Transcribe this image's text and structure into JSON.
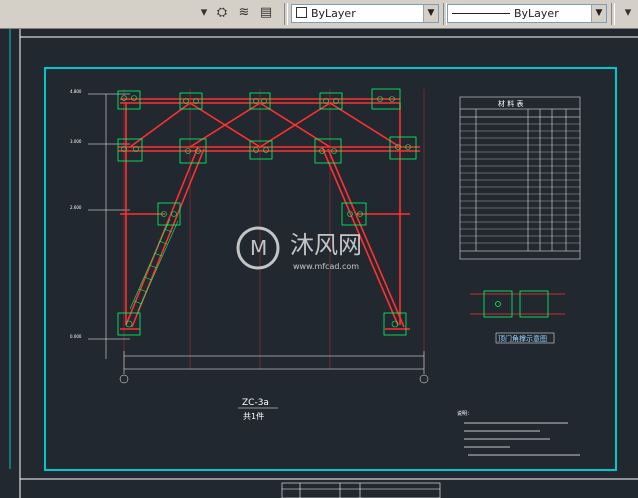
{
  "toolbar": {
    "icons": [
      "layer-dropdown-arrow-icon",
      "layer-match-icon",
      "layer-previous-icon",
      "layer-states-icon"
    ],
    "color_value": "ByLayer",
    "linetype_value": "ByLayer"
  },
  "drawing": {
    "frame_color": "#00c8c8",
    "member_color": "#ff3030",
    "bolt_color": "#00ff66",
    "elevations": [
      "4.800",
      "3.000",
      "2.600",
      "0.000"
    ],
    "title": "ZC-3a",
    "subtitle": "共1件",
    "parts_table_title": "材 料 表",
    "detail_label": "顶门角撑示意图",
    "notes_header": "说明：",
    "watermark_text": "沐风网",
    "watermark_url": "www.mfcad.com"
  }
}
